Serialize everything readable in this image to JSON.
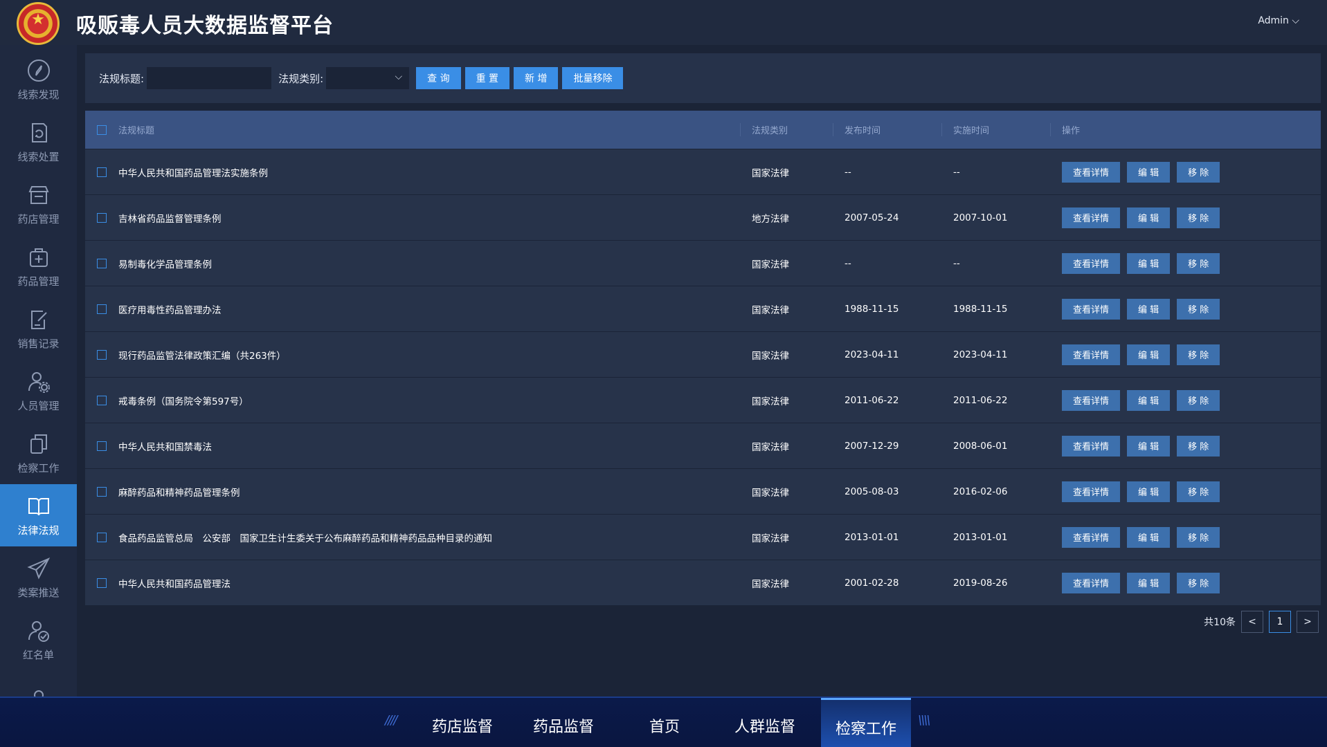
{
  "header": {
    "title": "吸贩毒人员大数据监督平台",
    "user": "Admin ⌵"
  },
  "sidebar": {
    "items": [
      {
        "label": "线索发现",
        "icon": "compass-icon"
      },
      {
        "label": "线索处置",
        "icon": "refresh-doc-icon"
      },
      {
        "label": "药店管理",
        "icon": "store-icon"
      },
      {
        "label": "药品管理",
        "icon": "medkit-icon"
      },
      {
        "label": "销售记录",
        "icon": "edit-doc-icon"
      },
      {
        "label": "人员管理",
        "icon": "user-gear-icon"
      },
      {
        "label": "检察工作",
        "icon": "copy-icon"
      },
      {
        "label": "法律法规",
        "icon": "book-icon"
      },
      {
        "label": "类案推送",
        "icon": "paper-plane-icon"
      },
      {
        "label": "红名单",
        "icon": "user-check-icon"
      }
    ],
    "active_index": 7
  },
  "search": {
    "title_label": "法规标题:",
    "title_value": "",
    "type_label": "法规类别:",
    "type_value": "",
    "buttons": {
      "query": "查 询",
      "reset": "重 置",
      "add": "新 增",
      "batch_remove": "批量移除"
    }
  },
  "table": {
    "headers": {
      "title": "法规标题",
      "type": "法规类别",
      "publish": "发布时间",
      "effective": "实施时间",
      "action": "操作"
    },
    "actions": {
      "detail": "查看详情",
      "edit": "编 辑",
      "remove": "移 除"
    },
    "rows": [
      {
        "title": "中华人民共和国药品管理法实施条例",
        "type": "国家法律",
        "publish": "--",
        "effective": "--"
      },
      {
        "title": "吉林省药品监督管理条例",
        "type": "地方法律",
        "publish": "2007-05-24",
        "effective": "2007-10-01"
      },
      {
        "title": "易制毒化学品管理条例",
        "type": "国家法律",
        "publish": "--",
        "effective": "--"
      },
      {
        "title": "医疗用毒性药品管理办法",
        "type": "国家法律",
        "publish": "1988-11-15",
        "effective": "1988-11-15"
      },
      {
        "title": "现行药品监管法律政策汇编（共263件）",
        "type": "国家法律",
        "publish": "2023-04-11",
        "effective": "2023-04-11"
      },
      {
        "title": "戒毒条例（国务院令第597号）",
        "type": "国家法律",
        "publish": "2011-06-22",
        "effective": "2011-06-22"
      },
      {
        "title": "中华人民共和国禁毒法",
        "type": "国家法律",
        "publish": "2007-12-29",
        "effective": "2008-06-01"
      },
      {
        "title": "麻醉药品和精神药品管理条例",
        "type": "国家法律",
        "publish": "2005-08-03",
        "effective": "2016-02-06"
      },
      {
        "title": "食品药品监管总局　公安部　国家卫生计生委关于公布麻醉药品和精神药品品种目录的通知",
        "type": "国家法律",
        "publish": "2013-01-01",
        "effective": "2013-01-01"
      },
      {
        "title": "中华人民共和国药品管理法",
        "type": "国家法律",
        "publish": "2001-02-28",
        "effective": "2019-08-26"
      }
    ]
  },
  "pagination": {
    "total": "共10条",
    "prev": "<",
    "current": "1",
    "next": ">"
  },
  "bottom_nav": {
    "tabs": [
      "药店监督",
      "药品监督",
      "首页",
      "人群监督",
      "检察工作"
    ],
    "active_index": 4
  },
  "colors": {
    "accent": "#3a8ee6",
    "sidebar_active": "#2f80cf",
    "table_header": "#3a5383"
  }
}
